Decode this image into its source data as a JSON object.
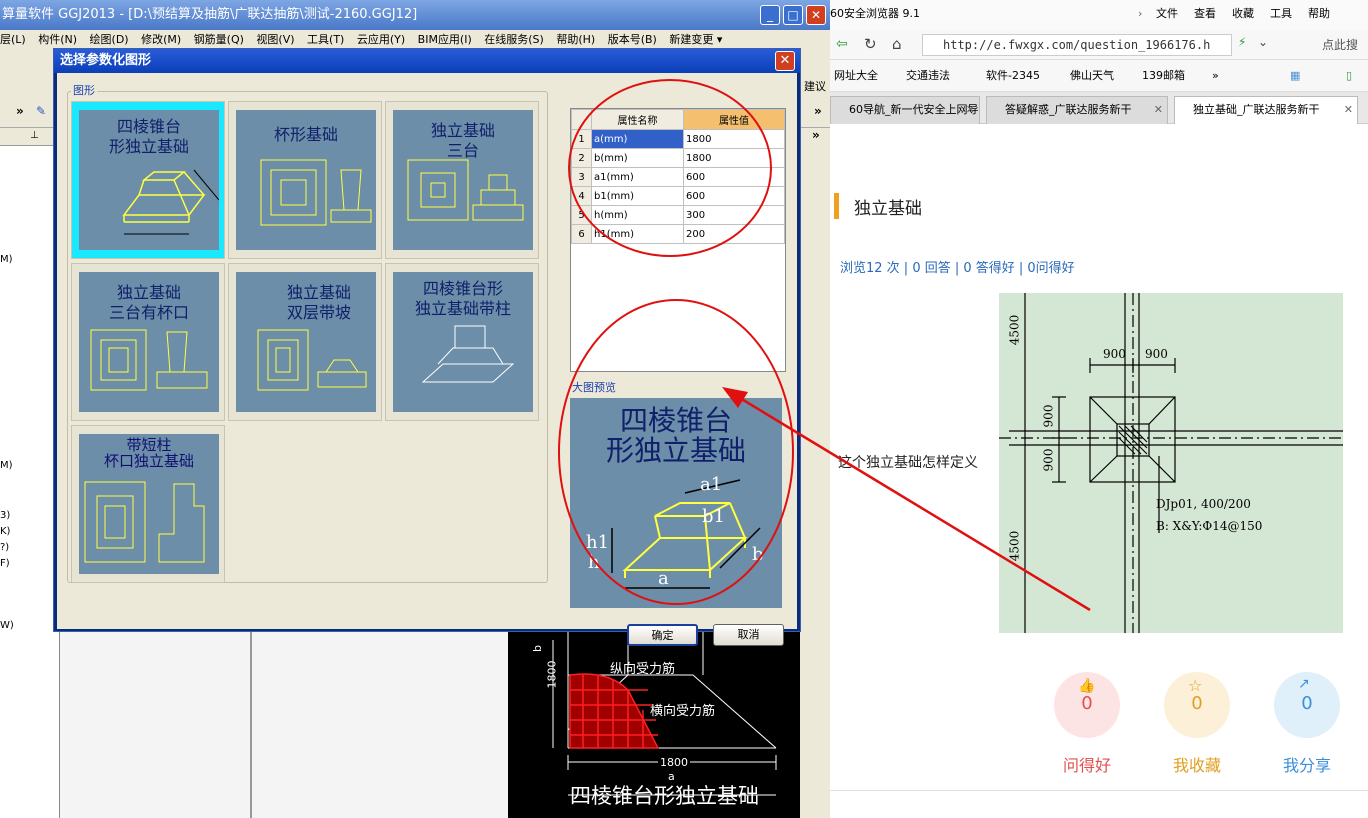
{
  "app": {
    "title": "算量软件 GGJ2013 - [D:\\预结算及抽筋\\广联达抽筋\\测试-2160.GGJ12]",
    "menu": [
      "层(L)",
      "构件(N)",
      "绘图(D)",
      "修改(M)",
      "钢筋量(Q)",
      "视图(V)",
      "工具(T)",
      "云应用(Y)",
      "BIM应用(I)",
      "在线服务(S)",
      "帮助(H)",
      "版本号(B)",
      "新建变更 ▾"
    ],
    "toolbar_right": "建议",
    "left_marks": [
      "M)",
      "M)",
      "3)",
      "K)",
      "?)",
      "F)",
      "W)"
    ]
  },
  "dialog": {
    "title": "选择参数化图形",
    "shapes_group": "图形",
    "shapes": [
      {
        "label1": "四棱锥台",
        "label2": "形独立基础",
        "selected": true
      },
      {
        "label1": "杯形基础",
        "label2": ""
      },
      {
        "label1": "独立基础",
        "label2": "三台"
      },
      {
        "label1": "独立基础",
        "label2": "三台有杯口"
      },
      {
        "label1": "独立基础",
        "label2": "双层带坡"
      },
      {
        "label1": "四棱锥台形",
        "label2": "独立基础带柱"
      },
      {
        "label1": "带短柱",
        "label2": "杯口独立基础"
      }
    ],
    "props_headers": {
      "name": "属性名称",
      "value": "属性值"
    },
    "props": [
      {
        "idx": "1",
        "name": "a(mm)",
        "value": "1800"
      },
      {
        "idx": "2",
        "name": "b(mm)",
        "value": "1800"
      },
      {
        "idx": "3",
        "name": "a1(mm)",
        "value": "600"
      },
      {
        "idx": "4",
        "name": "b1(mm)",
        "value": "600"
      },
      {
        "idx": "5",
        "name": "h(mm)",
        "value": "300"
      },
      {
        "idx": "6",
        "name": "h1(mm)",
        "value": "200"
      }
    ],
    "preview_label": "大图预览",
    "preview_title1": "四棱锥台",
    "preview_title2": "形独立基础",
    "ok": "确定",
    "cancel": "取消"
  },
  "cad": {
    "b_label": "b",
    "dim_vert": "1800",
    "label_long": "纵向受力筋",
    "label_trans": "横向受力筋",
    "dim_horiz": "1800",
    "a_label": "a",
    "caption": "四棱锥台形独立基础"
  },
  "browser": {
    "title": "60安全浏览器 9.1",
    "menu": [
      "文件",
      "查看",
      "收藏",
      "工具",
      "帮助"
    ],
    "url": "http://e.fwxgx.com/question_1966176.h",
    "search_placeholder": "点此搜",
    "favorites": [
      "网址大全",
      "交通违法",
      "软件-2345",
      "佛山天气",
      "139邮箱"
    ],
    "tabs": [
      "60导航_新一代安全上网导",
      "答疑解惑_广联达服务新干",
      "独立基础_广联达服务新干"
    ],
    "question_title": "独立基础",
    "stats": "浏览12 次 | 0 回答 | 0 答得好 | 0问得好",
    "question_text": "这个独立基础怎样定义",
    "drawing": {
      "dim1": "900",
      "dim2": "900",
      "side1": "900",
      "side2": "900",
      "top": "4500",
      "bottom": "4500",
      "note1": "DJp01, 400/200",
      "note2": "B: X&Y:Φ14@150"
    },
    "actions": [
      {
        "label": "问得好",
        "count": "0",
        "color": "#e05050",
        "bg": "#fde4e4"
      },
      {
        "label": "我收藏",
        "count": "0",
        "color": "#e0a020",
        "bg": "#fdf0d8"
      },
      {
        "label": "我分享",
        "count": "0",
        "color": "#3a90d8",
        "bg": "#dff0fb"
      }
    ]
  }
}
